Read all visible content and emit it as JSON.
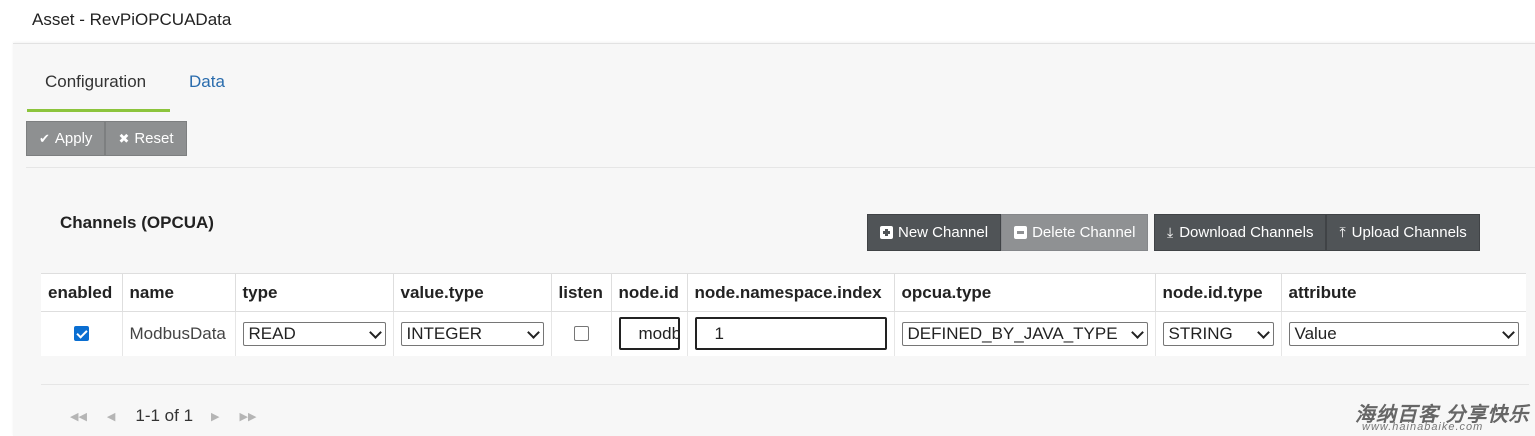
{
  "window": {
    "title": "Asset - RevPiOPCUAData"
  },
  "tabs": [
    {
      "label": "Configuration",
      "active": true
    },
    {
      "label": "Data",
      "active": false
    }
  ],
  "toolbar": {
    "apply_label": "Apply",
    "reset_label": "Reset"
  },
  "section": {
    "title": "Channels (OPCUA)"
  },
  "actions": {
    "new_label": "New Channel",
    "delete_label": "Delete Channel",
    "download_label": "Download Channels",
    "upload_label": "Upload Channels"
  },
  "table": {
    "columns": [
      "enabled",
      "name",
      "type",
      "value.type",
      "listen",
      "node.id",
      "node.namespace.index",
      "opcua.type",
      "node.id.type",
      "attribute"
    ],
    "rows": [
      {
        "enabled": true,
        "name": "ModbusData",
        "type": "READ",
        "value_type": "INTEGER",
        "listen": false,
        "node_id": "modbusData",
        "node_namespace_index": "1",
        "opcua_type": "DEFINED_BY_JAVA_TYPE",
        "node_id_type": "STRING",
        "attribute": "Value"
      }
    ]
  },
  "pager": {
    "range_text": "1-1 of 1"
  },
  "watermark": {
    "line1": "海纳百客 分享快乐",
    "line2": "www.hainabaike.com"
  },
  "colors": {
    "accent": "#8cc43c",
    "link": "#2a6cad",
    "dark_button": "#505457",
    "grey_button": "#8e9091",
    "checkbox": "#0a6ed1"
  }
}
